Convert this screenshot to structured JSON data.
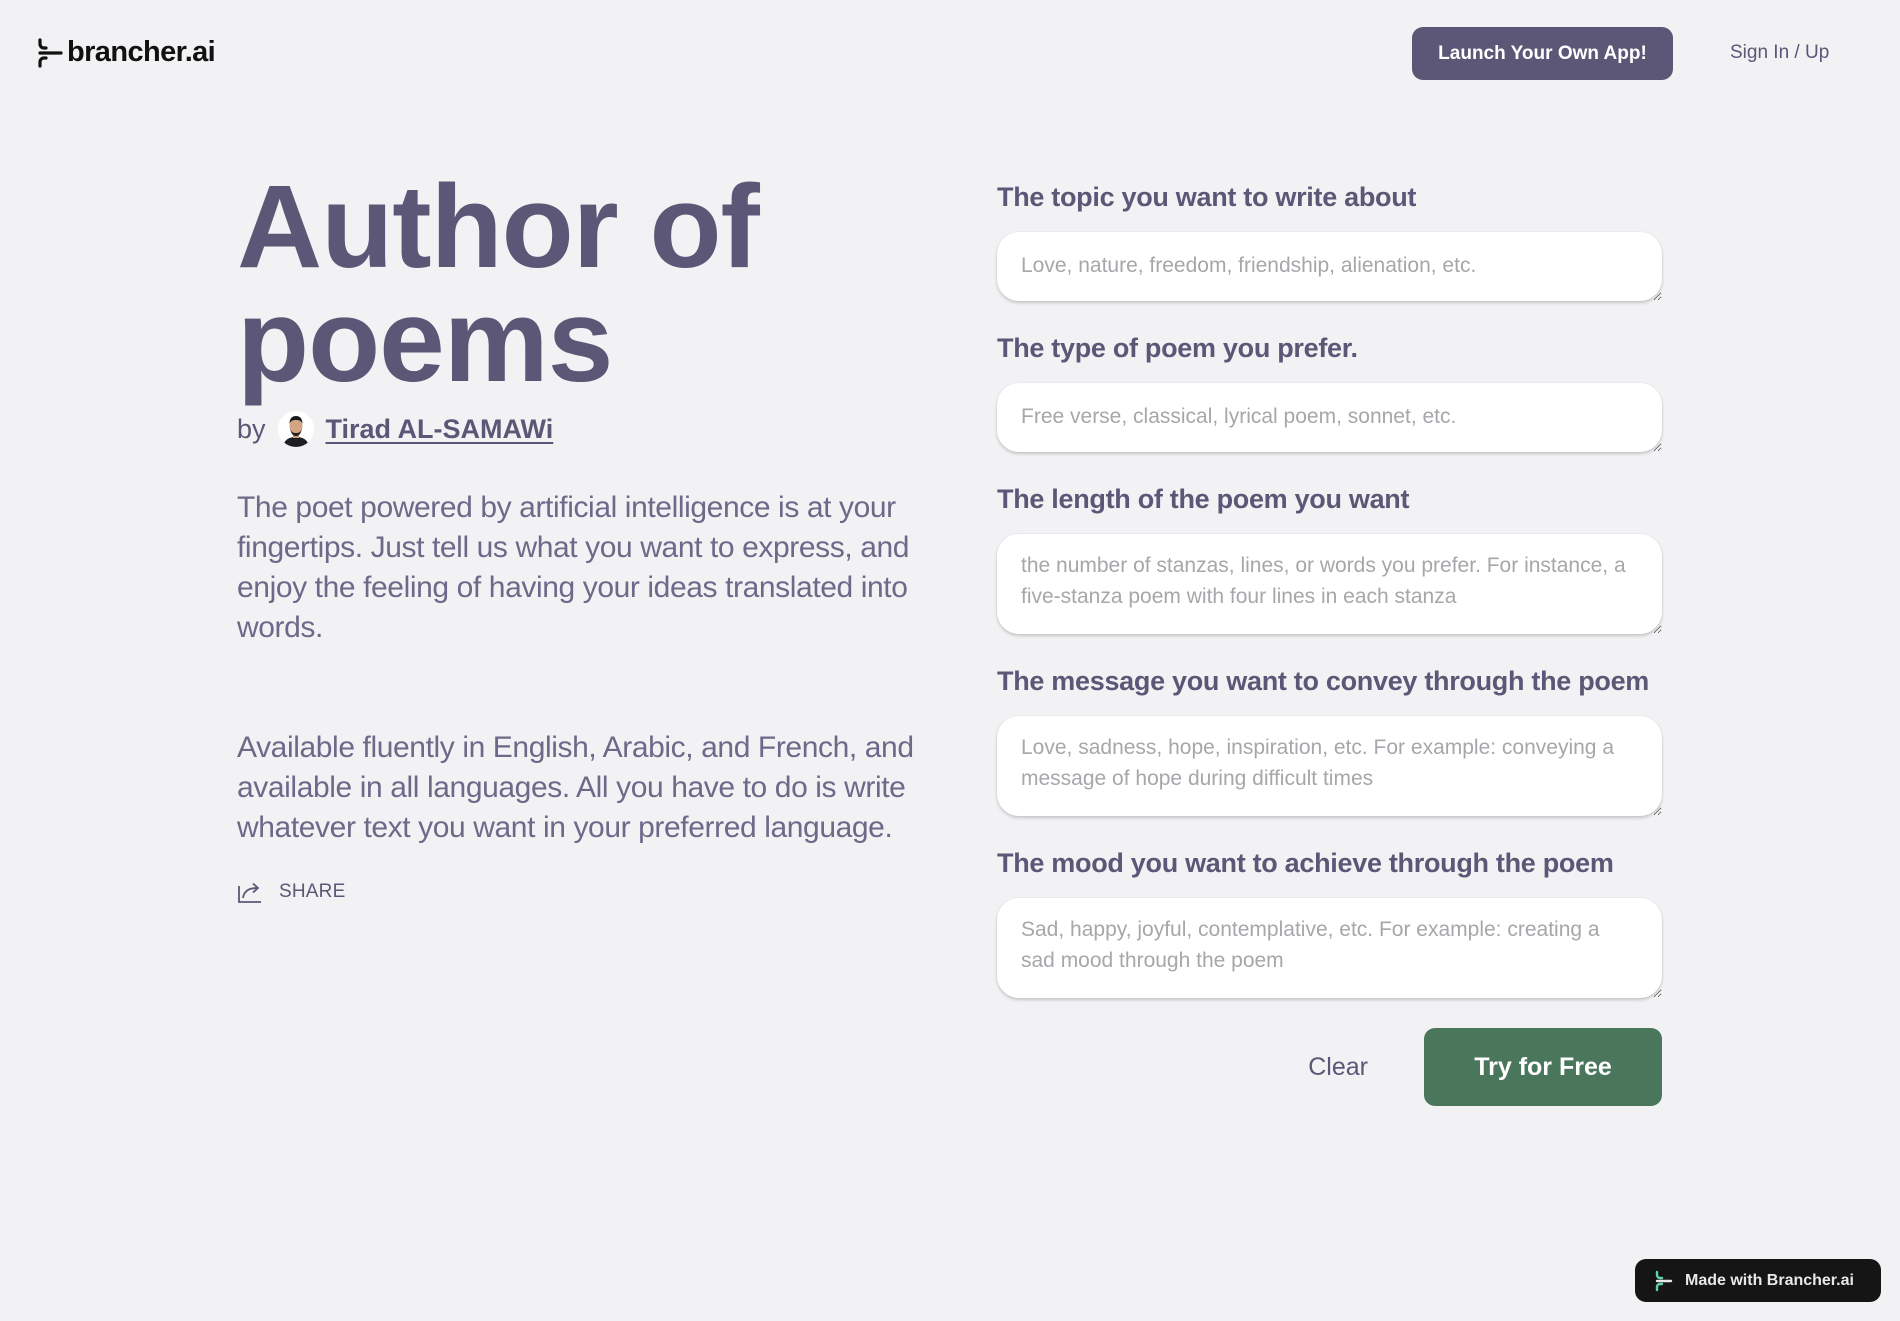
{
  "header": {
    "logo_text": "brancher.ai",
    "logo_icon": "brancher-logo-icon",
    "launch_button": "Launch Your Own App!",
    "signin_link": "Sign In / Up"
  },
  "hero": {
    "title": "Author of poems",
    "by_label": "by",
    "author_name": "Tirad AL-SAMAWi",
    "description_1": "The poet powered by artificial intelligence is at your fingertips. Just tell us what you want to express, and enjoy the feeling of having your ideas translated into words.",
    "description_2": "Available fluently in English, Arabic, and French, and available in all languages. All you have to do is write whatever text you want in your preferred language.",
    "share_label": "SHARE",
    "share_icon": "share-icon"
  },
  "form": {
    "fields": [
      {
        "label": "The topic you want to write about",
        "placeholder": "Love, nature, freedom, friendship, alienation, etc.",
        "value": ""
      },
      {
        "label": "The type of poem you prefer.",
        "placeholder": "Free verse, classical, lyrical poem, sonnet, etc.",
        "value": ""
      },
      {
        "label": "The length of the poem you want",
        "placeholder": "the number of stanzas, lines, or words you prefer. For instance, a five-stanza poem with four lines in each stanza",
        "value": ""
      },
      {
        "label": "The message you want to convey through the poem",
        "placeholder": "Love, sadness, hope, inspiration, etc. For example: conveying a message of hope during difficult times",
        "value": ""
      },
      {
        "label": "The mood you want to achieve through the poem",
        "placeholder": "Sad, happy, joyful, contemplative, etc. For example: creating a sad mood through the poem",
        "value": ""
      }
    ],
    "clear_button": "Clear",
    "submit_button": "Try for Free"
  },
  "badge": {
    "label": "Made with Brancher.ai"
  },
  "colors": {
    "background": "#f2f2f4",
    "primary": "#5c5677",
    "submit": "#4a775c",
    "badge_bg": "#151515",
    "badge_accent": "#5fd6a8"
  }
}
